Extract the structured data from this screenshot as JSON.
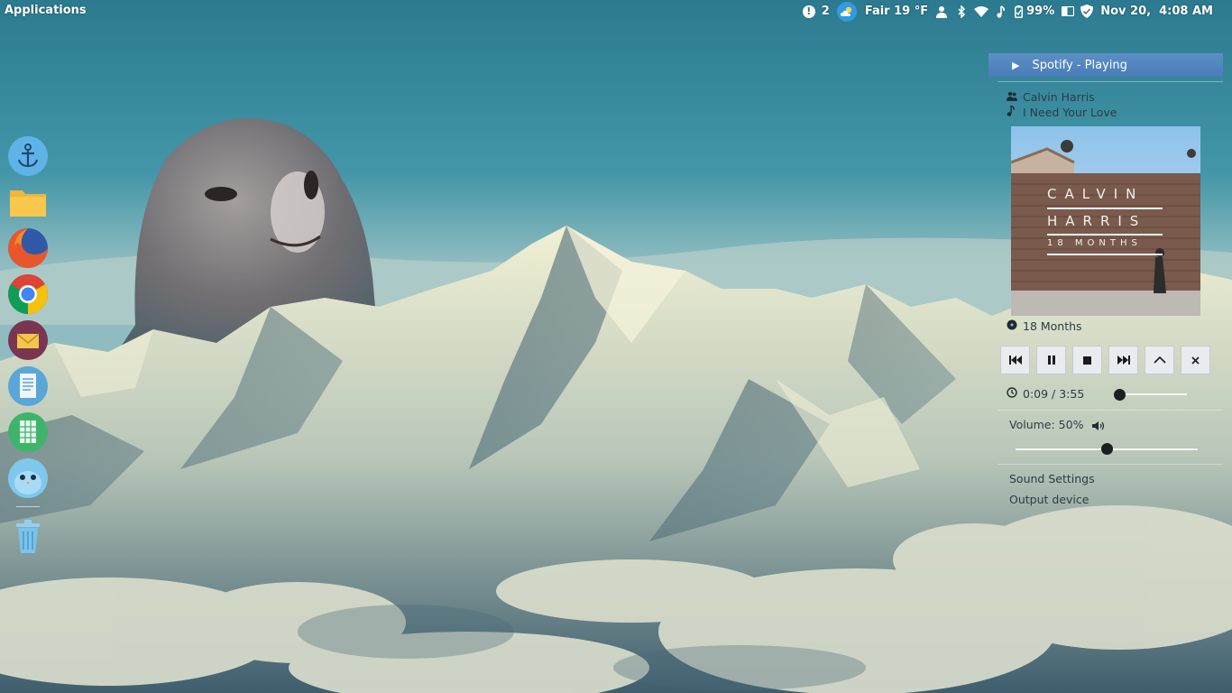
{
  "top_panel": {
    "apps_menu_label": "Applications",
    "notification_count": "2",
    "weather": "Fair 19 °F",
    "battery": "99%",
    "clock": "Nov 20,  4:08 AM",
    "icons": [
      "alert-icon",
      "weather-icon",
      "user-icon",
      "bluetooth-icon",
      "wifi-icon",
      "music-icon",
      "battery-icon",
      "toggle-icon",
      "shield-icon"
    ]
  },
  "dock": {
    "items": [
      "anchor-icon",
      "folder-icon",
      "firefox-icon",
      "chrome-icon",
      "mail-icon",
      "document-icon",
      "spreadsheet-icon",
      "bird-icon",
      "trash-icon"
    ]
  },
  "sound_menu": {
    "player_title": "Spotify - Playing",
    "artist": "Calvin Harris",
    "track": "I Need Your Love",
    "album": "18 Months",
    "album_art": {
      "line1": "CALVIN",
      "line2": "HARRIS",
      "line3": "18 MONTHS"
    },
    "controls": [
      "previous",
      "pause",
      "stop",
      "next",
      "raise",
      "close"
    ],
    "time": "0:09 / 3:55",
    "progress": 0.04,
    "volume_label": "Volume: 50%",
    "volume": 0.5,
    "settings_label": "Sound Settings",
    "output_label": "Output device"
  },
  "colors": {
    "header_blue": "#4e82bc",
    "weather_blue": "#2f9be0",
    "sky": "#2f7d92"
  }
}
